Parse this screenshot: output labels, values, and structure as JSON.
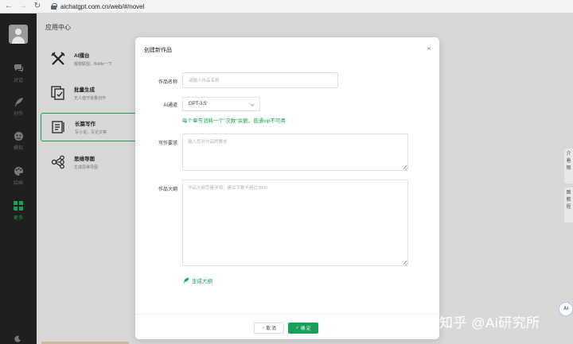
{
  "browser": {
    "back": "←",
    "forward": "→",
    "reload": "↻",
    "url": "aichatgpt.com.cn/web/#/novel"
  },
  "rail": {
    "items": [
      {
        "label": "对话",
        "icon": "chat-icon"
      },
      {
        "label": "创作",
        "icon": "feather-icon"
      },
      {
        "label": "模拟",
        "icon": "mask-icon"
      },
      {
        "label": "绘画",
        "icon": "palette-icon"
      },
      {
        "label": "更多",
        "icon": "grid-icon"
      }
    ]
  },
  "panel": {
    "title": "应用中心",
    "apps": [
      {
        "title": "AI擂台",
        "desc": "靓丽联盟，Battle一下",
        "icon": "crossed-swords-icon"
      },
      {
        "title": "批量生成",
        "desc": "无人值守批量创作",
        "icon": "batch-doc-icon"
      },
      {
        "title": "长篇写作",
        "desc": "写小说，写论文等",
        "icon": "long-doc-icon"
      },
      {
        "title": "思维导图",
        "desc": "生成思维导图",
        "icon": "mindmap-icon"
      }
    ]
  },
  "side_tabs": [
    {
      "chars": [
        "介",
        "着",
        "眼"
      ]
    },
    {
      "chars": [
        "图",
        "教",
        "程"
      ]
    }
  ],
  "float_button": "AI",
  "watermark": "知乎 @Ai研究所",
  "modal": {
    "title": "创建新作品",
    "close": "×",
    "name_label": "作品名称",
    "name_placeholder": "请输入作品名称",
    "channel_label": "AI通道",
    "channel_value": "GPT-3.5",
    "channel_hint": "每个章节消耗一个\"次数\"余额，普通vip不可用",
    "req_label": "写作要求",
    "req_placeholder": "输入您对作品的要求",
    "outline_label": "作品大纲",
    "outline_placeholder": "作品大纲尽量详细，建议字数不超过3000",
    "generate_label": "生成大纲",
    "cancel_label": "取 消",
    "cancel_glyph": "×",
    "ok_label": "确 定",
    "ok_glyph": "✓"
  },
  "colors": {
    "accent": "#18a058",
    "rail_bg": "#1f1f1f",
    "panel_bg": "#d8d8d8"
  }
}
